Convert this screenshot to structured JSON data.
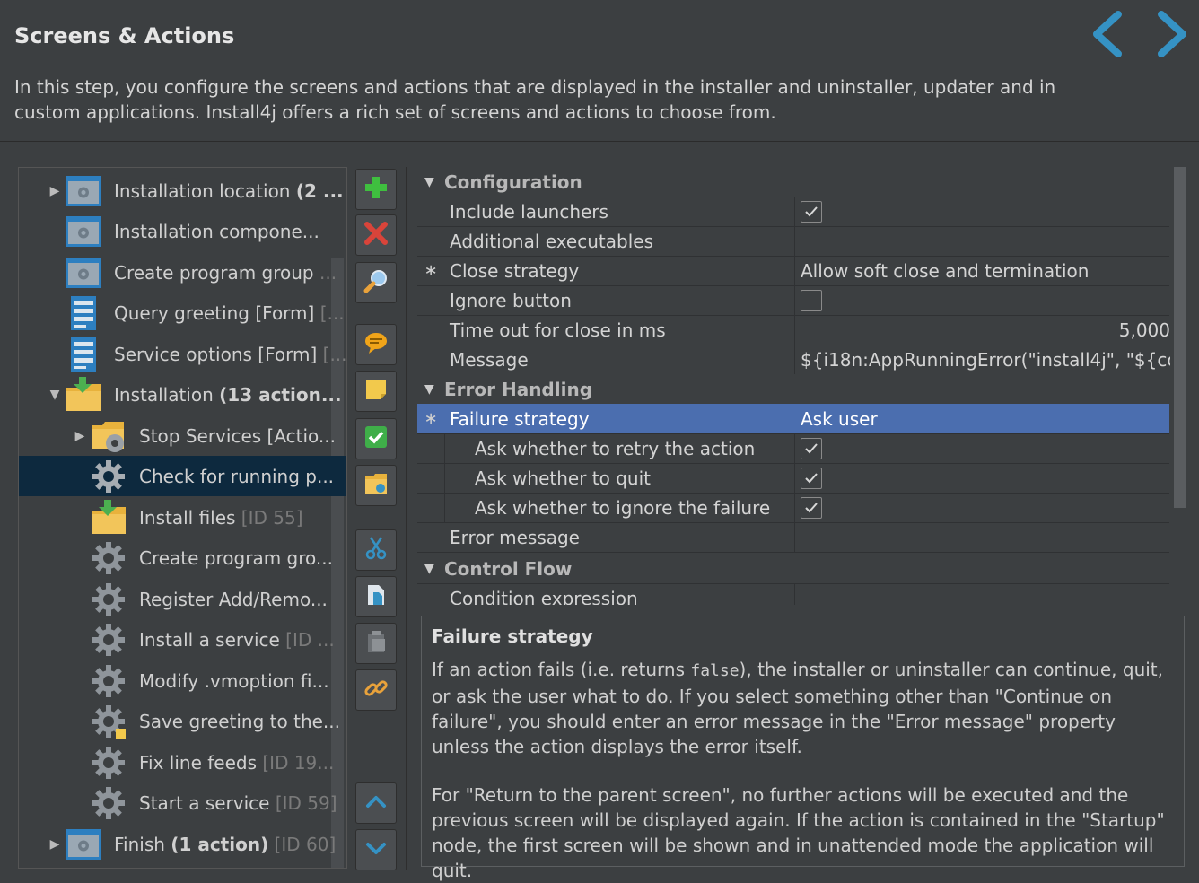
{
  "header": {
    "title": "Screens & Actions",
    "description": "In this step, you configure the screens and actions that are displayed in the installer and uninstaller, updater and in custom applications. Install4j offers a rich set of screens and actions to choose from."
  },
  "tree": {
    "items": [
      {
        "label": "Installation location",
        "bold": "(2 ...",
        "meta": ""
      },
      {
        "label": "Installation compone...",
        "bold": "",
        "meta": ""
      },
      {
        "label": "Create program group",
        "bold": "",
        "meta": " ..."
      },
      {
        "label": "Query greeting [Form]",
        "bold": "",
        "meta": " [..."
      },
      {
        "label": "Service options [Form]",
        "bold": "",
        "meta": " [..."
      },
      {
        "label": "Installation",
        "bold": "(13 action...",
        "meta": ""
      },
      {
        "label": "Stop Services [Actio...",
        "bold": "",
        "meta": ""
      },
      {
        "label": "Check for running p...",
        "bold": "",
        "meta": ""
      },
      {
        "label": "Install files",
        "bold": "",
        "meta": " [ID 55]"
      },
      {
        "label": "Create program gro...",
        "bold": "",
        "meta": ""
      },
      {
        "label": "Register Add/Remo...",
        "bold": "",
        "meta": ""
      },
      {
        "label": "Install a service",
        "bold": "",
        "meta": " [ID ..."
      },
      {
        "label": "Modify .vmoption fi...",
        "bold": "",
        "meta": ""
      },
      {
        "label": "Save greeting to the...",
        "bold": "",
        "meta": ""
      },
      {
        "label": "Fix line feeds",
        "bold": "",
        "meta": " [ID 19..."
      },
      {
        "label": "Start a service",
        "bold": "",
        "meta": " [ID 59]"
      },
      {
        "label": "Finish",
        "bold": "(1 action)",
        "meta": " [ID 60]"
      }
    ]
  },
  "toolbar": {
    "icons": [
      "add-icon",
      "delete-icon",
      "search-icon",
      "comment-icon",
      "note-icon",
      "check-icon",
      "folder-action-icon",
      "cut-icon",
      "copy-icon",
      "paste-icon",
      "link-icon",
      "move-up-icon",
      "move-down-icon"
    ]
  },
  "props": {
    "sec_config": "Configuration",
    "include_launchers": "Include launchers",
    "additional_executables": "Additional executables",
    "close_strategy": "Close strategy",
    "close_strategy_val": "Allow soft close and termination",
    "ignore_button": "Ignore button",
    "timeout": "Time out for close in ms",
    "timeout_val": "5,000",
    "message": "Message",
    "message_val": "${i18n:AppRunningError(\"install4j\", \"${com...",
    "sec_error": "Error Handling",
    "failure_strategy": "Failure strategy",
    "failure_strategy_val": "Ask user",
    "ask_retry": "Ask whether to retry the action",
    "ask_quit": "Ask whether to quit",
    "ask_ignore": "Ask whether to ignore the failure",
    "error_message": "Error message",
    "sec_flow": "Control Flow",
    "condition": "Condition expression",
    "star": "∗"
  },
  "help": {
    "title": "Failure strategy",
    "p1a": "If an action fails (i.e. returns ",
    "p1code": "false",
    "p1b": "), the installer or uninstaller can continue, quit, or ask the user what to do. If you select something other than \"Continue on failure\", you should enter an error message in the \"Error message\" property unless the action displays the error itself.",
    "p2": "For \"Return to the parent screen\", no further actions will be executed and the previous screen will be displayed again. If the action is contained in the \"Startup\" node, the first screen will be shown and in unattended mode the application will quit."
  },
  "colors": {
    "accent": "#4b6eaf",
    "nav_arrow": "#3592c4",
    "selection_tree": "#0d293e"
  }
}
